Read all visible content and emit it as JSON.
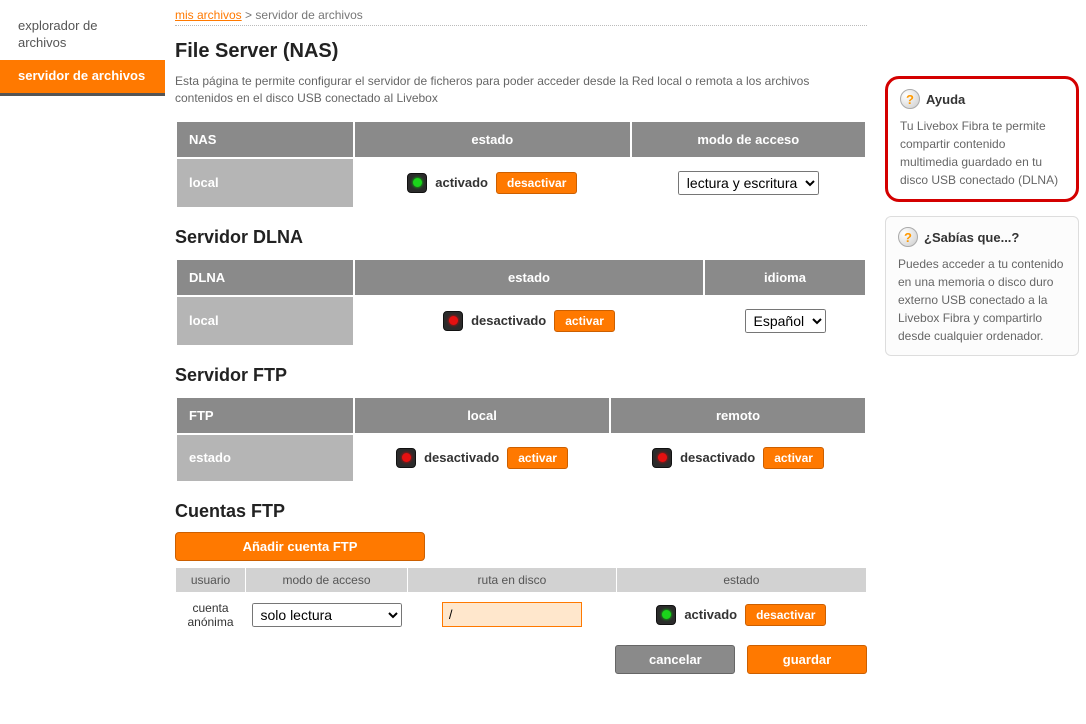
{
  "sidebar": {
    "items": [
      {
        "label": "explorador de archivos"
      },
      {
        "label": "servidor de archivos"
      }
    ]
  },
  "breadcrumb": {
    "link": "mis archivos",
    "sep": ">",
    "current": "servidor de archivos"
  },
  "nas": {
    "title": "File Server (NAS)",
    "desc": "Esta página te permite configurar el servidor de ficheros para poder acceder desde la Red local o remota a los archivos contenidos en el disco USB conectado al Livebox",
    "headers": [
      "NAS",
      "estado",
      "modo de acceso"
    ],
    "row_label": "local",
    "status_label": "activado",
    "btn": "desactivar",
    "mode_options": [
      "lectura y escritura"
    ],
    "mode_selected": "lectura y escritura"
  },
  "dlna": {
    "title": "Servidor DLNA",
    "headers": [
      "DLNA",
      "estado",
      "idioma"
    ],
    "row_label": "local",
    "status_label": "desactivado",
    "btn": "activar",
    "lang_options": [
      "Español"
    ],
    "lang_selected": "Español"
  },
  "ftp": {
    "title": "Servidor FTP",
    "headers": [
      "FTP",
      "local",
      "remoto"
    ],
    "row_label": "estado",
    "local_status": "desactivado",
    "local_btn": "activar",
    "remote_status": "desactivado",
    "remote_btn": "activar"
  },
  "accounts": {
    "title": "Cuentas FTP",
    "add_btn": "Añadir cuenta FTP",
    "headers": [
      "usuario",
      "modo de acceso",
      "ruta en disco",
      "estado"
    ],
    "rows": [
      {
        "user": "cuenta anónima",
        "mode_options": [
          "solo lectura"
        ],
        "mode_selected": "solo lectura",
        "path": "/",
        "status_label": "activado",
        "btn": "desactivar"
      }
    ]
  },
  "actions": {
    "cancel": "cancelar",
    "save": "guardar"
  },
  "help1": {
    "title": "Ayuda",
    "text": "Tu Livebox Fibra te permite compartir contenido multimedia guardado en tu disco USB conectado (DLNA)"
  },
  "help2": {
    "title": "¿Sabías que...?",
    "text": "Puedes acceder a tu contenido en una memoria o disco duro externo USB conectado a la Livebox Fibra y compartirlo desde cualquier ordenador."
  }
}
